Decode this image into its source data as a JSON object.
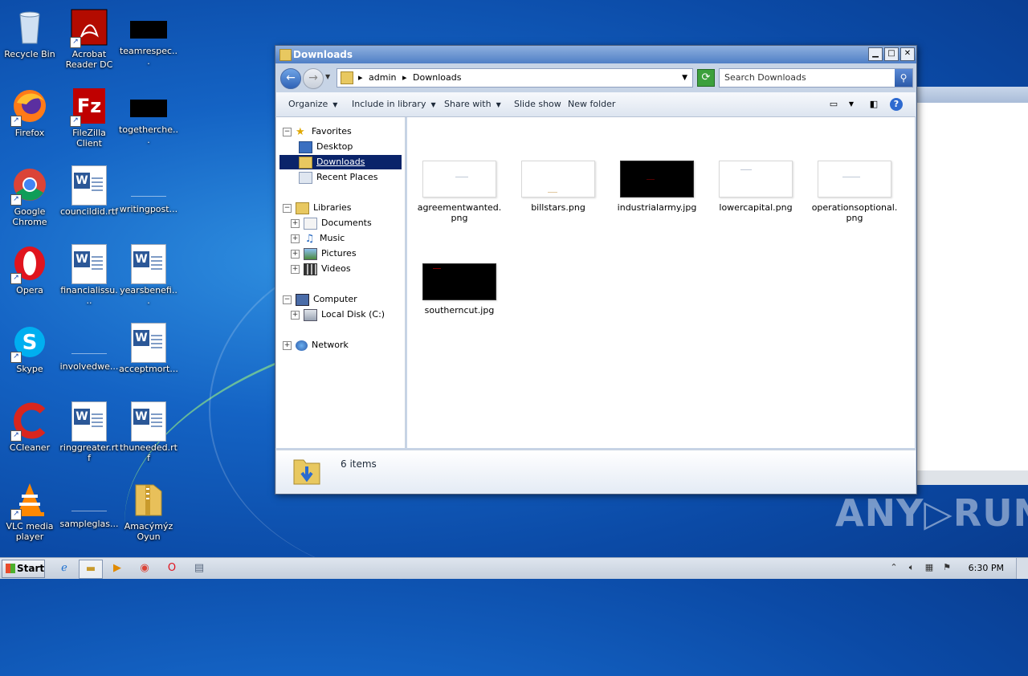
{
  "desktop": {
    "icons": [
      {
        "label": "Recycle Bin",
        "icon": "recycle-bin-icon"
      },
      {
        "label": "Acrobat\nReader DC",
        "icon": "acrobat-icon"
      },
      {
        "label": "teamrespec...",
        "icon": "black-file-icon"
      },
      {
        "label": "Firefox",
        "icon": "firefox-icon"
      },
      {
        "label": "FileZilla Client",
        "icon": "filezilla-icon"
      },
      {
        "label": "togetherche...",
        "icon": "black-file-icon"
      },
      {
        "label": "Google\nChrome",
        "icon": "chrome-icon"
      },
      {
        "label": "councildid.rtf",
        "icon": "word-doc-icon"
      },
      {
        "label": "writingpost...",
        "icon": "blank-file-icon"
      },
      {
        "label": "Opera",
        "icon": "opera-icon"
      },
      {
        "label": "financialissu...",
        "icon": "word-doc-icon"
      },
      {
        "label": "yearsbenefi...",
        "icon": "word-doc-icon"
      },
      {
        "label": "Skype",
        "icon": "skype-icon"
      },
      {
        "label": "involvedwe...",
        "icon": "blank-file-icon"
      },
      {
        "label": "acceptmort...",
        "icon": "word-doc-icon"
      },
      {
        "label": "CCleaner",
        "icon": "ccleaner-icon"
      },
      {
        "label": "ringgreater.rtf",
        "icon": "word-doc-icon"
      },
      {
        "label": "thuneeded.rtf",
        "icon": "word-doc-icon"
      },
      {
        "label": "VLC media\nplayer",
        "icon": "vlc-icon"
      },
      {
        "label": "sampleglas...",
        "icon": "blank-file-icon"
      },
      {
        "label": "Amacýmýz\nOyun",
        "icon": "zip-folder-icon"
      }
    ]
  },
  "window": {
    "title": "Downloads",
    "address": {
      "crumbs": [
        "admin",
        "Downloads"
      ]
    },
    "search_placeholder": "Search Downloads",
    "toolbar": {
      "organize": "Organize",
      "include_in_library": "Include in library",
      "share_with": "Share with",
      "slide_show": "Slide show",
      "new_folder": "New folder"
    },
    "nav": {
      "favorites": "Favorites",
      "desktop": "Desktop",
      "downloads": "Downloads",
      "recent_places": "Recent Places",
      "libraries": "Libraries",
      "documents": "Documents",
      "music": "Music",
      "pictures": "Pictures",
      "videos": "Videos",
      "computer": "Computer",
      "local_disk": "Local Disk (C:)",
      "network": "Network"
    },
    "files": [
      {
        "name": "agreementwanted.\npng",
        "dark": false
      },
      {
        "name": "billstars.png",
        "dark": false
      },
      {
        "name": "industrialarmy.jpg",
        "dark": true
      },
      {
        "name": "lowercapital.png",
        "dark": false
      },
      {
        "name": "operationsoptional.\npng",
        "dark": false
      },
      {
        "name": "southerncut.jpg",
        "dark": true
      }
    ],
    "status": "6 items"
  },
  "watermark": "ANY▷RUN",
  "taskbar": {
    "start": "Start",
    "clock": "6:30 PM"
  },
  "colors": {
    "selection": "#0a246a",
    "accent": "#2f62b6"
  }
}
